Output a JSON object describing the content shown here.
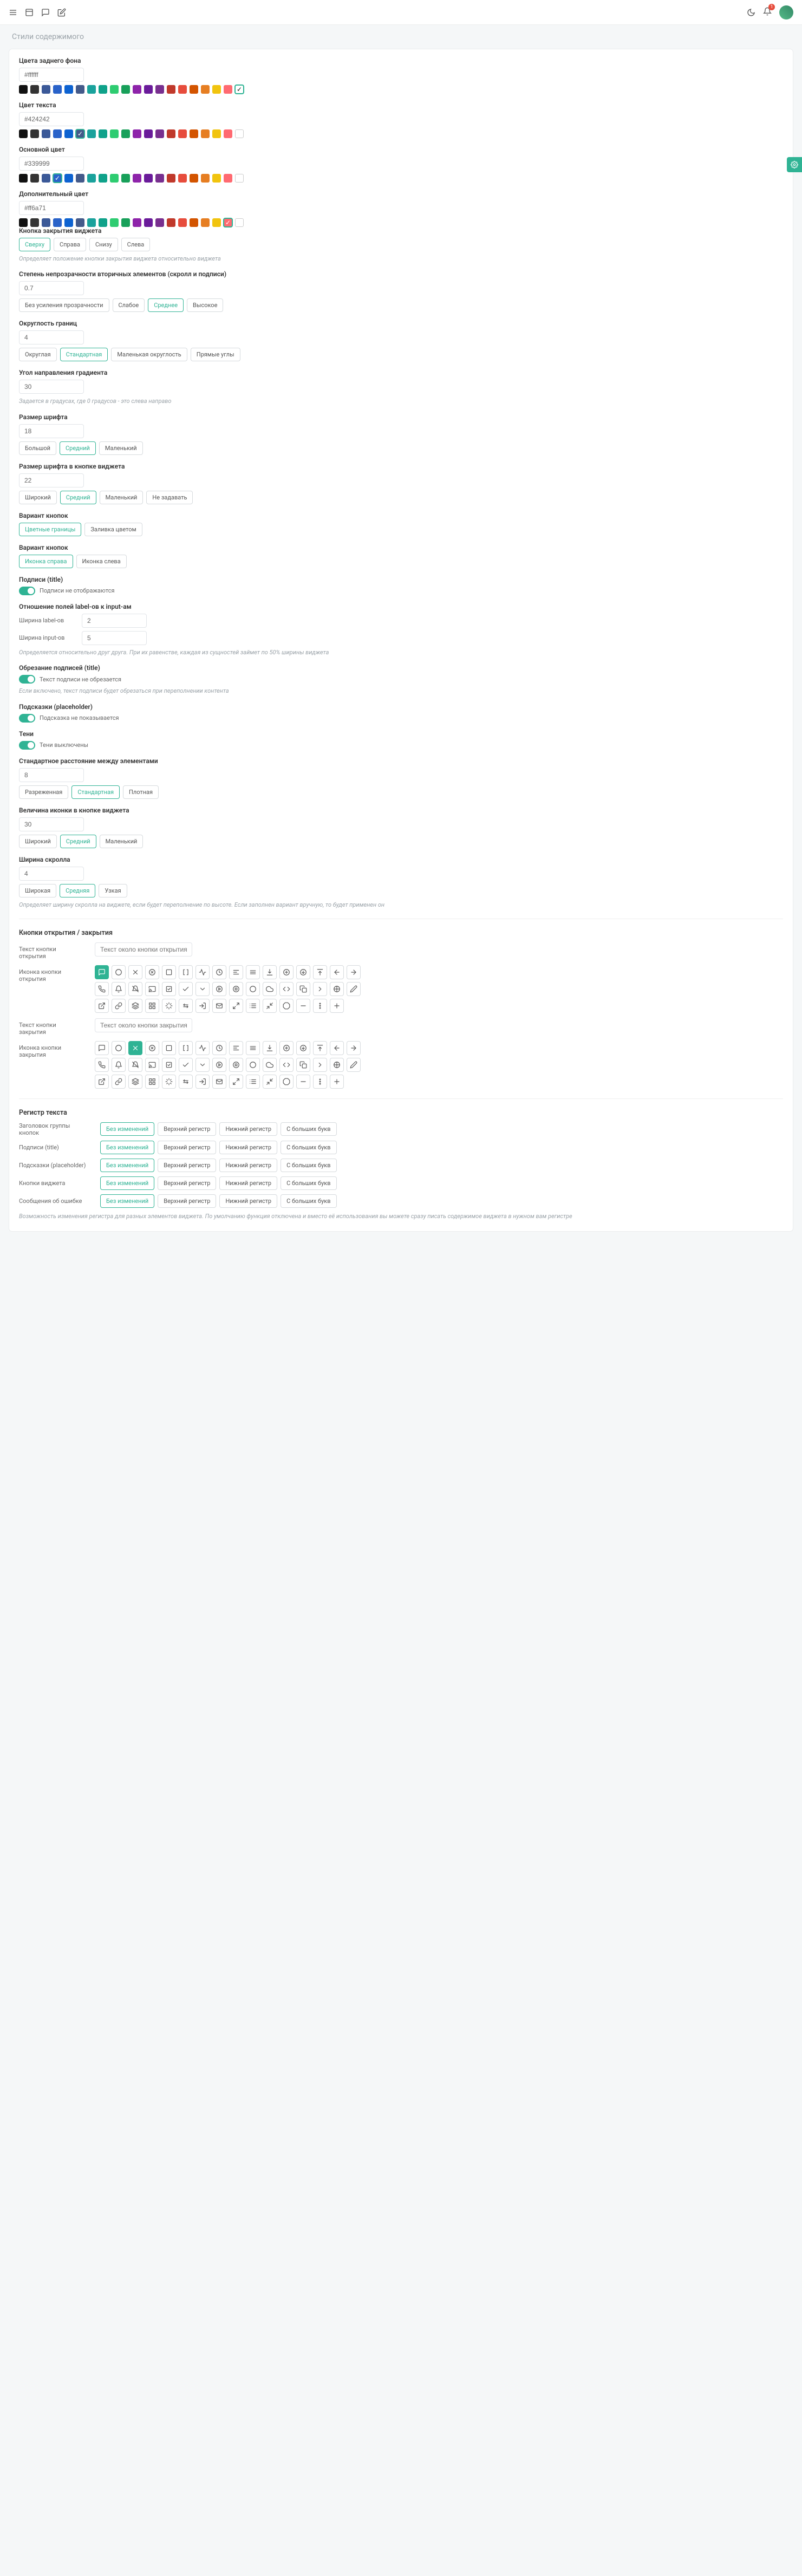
{
  "page_title": "Стили содержимого",
  "colors_palette": [
    "#111111",
    "#333333",
    "#3b5998",
    "#2962c9",
    "#0d62d1",
    "#445a8a",
    "#1aa29c",
    "#0fa28a",
    "#2ecc71",
    "#18a05a",
    "#8e24aa",
    "#6a1b9a",
    "#782f8f",
    "#c0392b",
    "#e74c3c",
    "#d35400",
    "#e67e22",
    "#f1c40f",
    "#ff6a71",
    "#ffffff"
  ],
  "sections": {
    "bg_color": {
      "label": "Цвета заднего фона",
      "value": "#ffffff",
      "selected_index": 19
    },
    "text_color": {
      "label": "Цвет текста",
      "value": "#424242",
      "selected_index": 5
    },
    "primary_color": {
      "label": "Основной цвет",
      "value": "#339999",
      "selected_index": 3
    },
    "secondary_color": {
      "label": "Дополнительный цвет",
      "value": "#ff6a71",
      "selected_index": 18
    },
    "close_button": {
      "label": "Кнопка закрытия виджета",
      "options": [
        "Сверху",
        "Справа",
        "Снизу",
        "Слева"
      ],
      "selected": 0,
      "help": "Определяет положение кнопки закрытия виджета относительно виджета"
    },
    "opacity": {
      "label": "Степень непрозрачности вторичных элементов (скролл и подписи)",
      "value": "0.7",
      "options": [
        "Без усиления прозрачности",
        "Слабое",
        "Среднее",
        "Высокое"
      ],
      "selected": 2
    },
    "roundness": {
      "label": "Округлость границ",
      "value": "4",
      "options": [
        "Округлая",
        "Стандартная",
        "Маленькая округлость",
        "Прямые углы"
      ],
      "selected": 1
    },
    "gradient_angle": {
      "label": "Угол направления градиента",
      "value": "30",
      "help": "Задается в градусах, где 0 градусов - это слева направо"
    },
    "font_size": {
      "label": "Размер шрифта",
      "value": "18",
      "options": [
        "Большой",
        "Средний",
        "Маленький"
      ],
      "selected": 1
    },
    "widget_btn_font": {
      "label": "Размер шрифта в кнопке виджета",
      "value": "22",
      "options": [
        "Широкий",
        "Средний",
        "Маленький",
        "Не задавать"
      ],
      "selected": 1
    },
    "button_variant1": {
      "label": "Вариант кнопок",
      "options": [
        "Цветные границы",
        "Заливка цветом"
      ],
      "selected": 0
    },
    "button_variant2": {
      "label": "Вариант кнопок",
      "options": [
        "Иконка справа",
        "Иконка слева"
      ],
      "selected": 0
    },
    "titles": {
      "label": "Подписи (title)",
      "toggle_label": "Подписи не отображаются"
    },
    "label_ratio": {
      "label": "Отношение полей label-ов к input-ам",
      "rows": [
        {
          "name": "Ширина label-ов",
          "value": "2"
        },
        {
          "name": "Ширина input-ов",
          "value": "5"
        }
      ],
      "help": "Определяется относительно друг друга. При их равенстве, каждая из сущностей займет по 50% ширины виджета"
    },
    "title_truncate": {
      "label": "Обрезание подписей (title)",
      "toggle_label": "Текст подписи не обрезается",
      "help": "Если включено, текст подписи будет обрезаться при переполнении контента"
    },
    "placeholders": {
      "label": "Подсказки (placeholder)",
      "toggle_label": "Подсказка не показывается"
    },
    "shadows": {
      "label": "Тени",
      "toggle_label": "Тени выключены"
    },
    "spacing": {
      "label": "Стандартное расстояние между элементами",
      "value": "8",
      "options": [
        "Разреженная",
        "Стандартная",
        "Плотная"
      ],
      "selected": 1
    },
    "widget_icon_size": {
      "label": "Величина иконки в кнопке виджета",
      "value": "30",
      "options": [
        "Широкий",
        "Средний",
        "Маленький"
      ],
      "selected": 1
    },
    "scroll_width": {
      "label": "Ширина скролла",
      "value": "4",
      "options": [
        "Широкая",
        "Средняя",
        "Узкая"
      ],
      "selected": 1,
      "help": "Определяет ширину скролла на виджете, если будет переполнение по высоте. Если заполнен вариант вручную, то будет применен он"
    }
  },
  "open_close": {
    "heading": "Кнопки открытия / закрытия",
    "open_text_label": "Текст кнопки открытия",
    "open_text_placeholder": "Текст около кнопки открытия",
    "open_icon_label": "Иконка кнопки открытия",
    "close_text_label": "Текст кнопки закрытия",
    "close_text_placeholder": "Текст около кнопки закрытия",
    "close_icon_label": "Иконка кнопки закрытия",
    "open_selected_index": 0,
    "close_selected_index": 2
  },
  "text_register": {
    "heading": "Регистр текста",
    "options": [
      "Без изменений",
      "Верхний регистр",
      "Нижний регистр",
      "С больших букв"
    ],
    "rows": [
      {
        "label": "Заголовок группы кнопок",
        "selected": 0
      },
      {
        "label": "Подписи (title)",
        "selected": 0
      },
      {
        "label": "Подсказки (placeholder)",
        "selected": 0
      },
      {
        "label": "Кнопки виджета",
        "selected": 0
      },
      {
        "label": "Сообщения об ошибке",
        "selected": 0
      }
    ],
    "help": "Возможность изменения регистра для разных элементов виджета. По умолчанию функция отключена и вместо её использования вы можете сразу писать содержимое виджета в нужном вам регистре"
  },
  "icon_names": [
    "chat",
    "circle",
    "x",
    "x-circle",
    "square",
    "square-brackets",
    "activity",
    "clock",
    "align-left",
    "menu",
    "download",
    "plus-circle",
    "arrow-down-circle",
    "upload",
    "arrow-left",
    "arrow-right",
    "phone",
    "bell",
    "bell-off",
    "cast",
    "check-square",
    "check",
    "chevron-down",
    "play-circle",
    "stop-circle",
    "circle-o",
    "cloud",
    "code",
    "copy",
    "chevron-right",
    "guide",
    "edit",
    "external-link",
    "link",
    "layers",
    "grid",
    "loader",
    "horizontal",
    "login",
    "mail",
    "expand",
    "list",
    "minimize",
    "octagon",
    "minus",
    "more-vertical",
    "plus"
  ]
}
